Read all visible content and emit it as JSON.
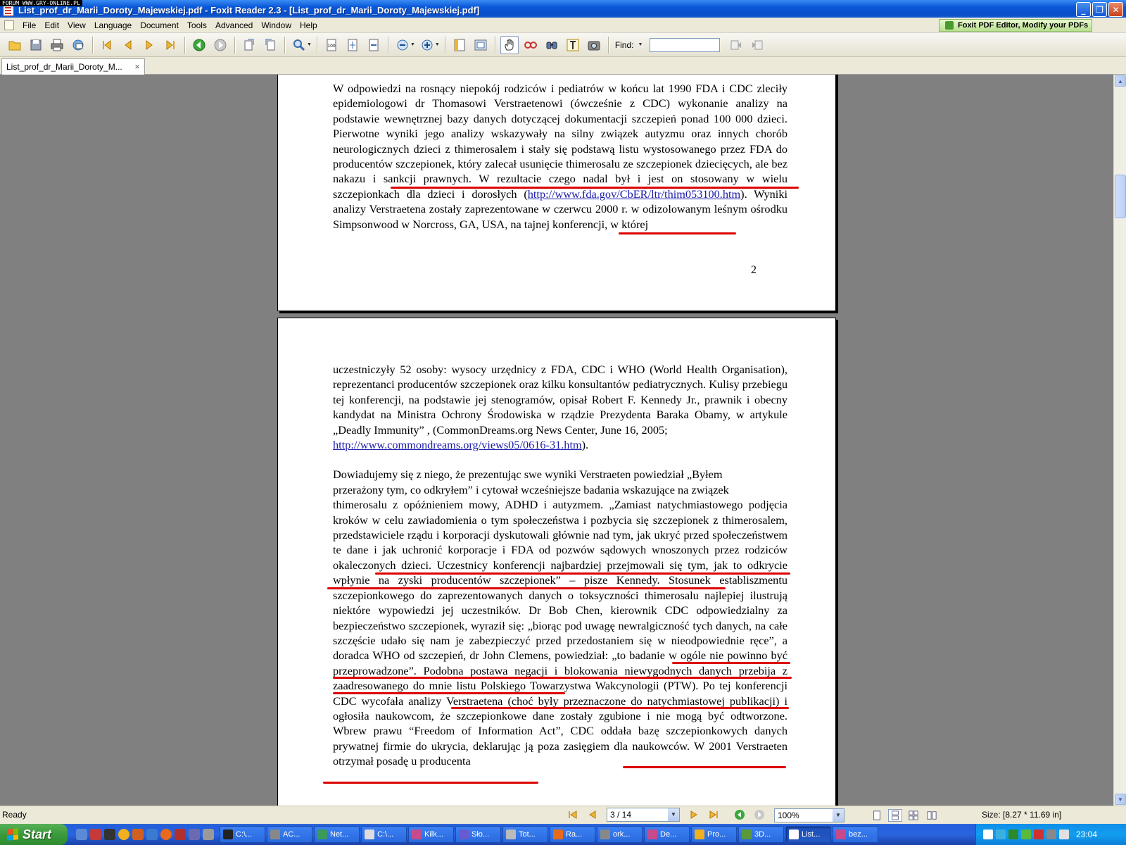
{
  "watermark": "FORUM WWW.GRY-ONLINE.PL",
  "window": {
    "title": "List_prof_dr_Marii_Doroty_Majewskiej.pdf - Foxit Reader 2.3 - [List_prof_dr_Marii_Doroty_Majewskiej.pdf]",
    "minimize": "_",
    "restore": "❐",
    "close": "✕"
  },
  "menu": {
    "items": [
      {
        "label": "File",
        "key": "F"
      },
      {
        "label": "Edit",
        "key": "E"
      },
      {
        "label": "View",
        "key": "V"
      },
      {
        "label": "Language",
        "key": "L"
      },
      {
        "label": "Document",
        "key": "D"
      },
      {
        "label": "Tools",
        "key": "T"
      },
      {
        "label": "Advanced",
        "key": "A"
      },
      {
        "label": "Window",
        "key": "W"
      },
      {
        "label": "Help",
        "key": "H"
      }
    ],
    "promo": "Foxit PDF Editor, Modify your PDFs"
  },
  "toolbar": {
    "find_label": "Find:",
    "find_value": ""
  },
  "tab": {
    "label": "List_prof_dr_Marii_Doroty_M...",
    "close": "×"
  },
  "page1": {
    "line1": "W odpowiedzi na rosnący niepokój rodziców i pediatrów w końcu lat 1990 FDA i CDC zleciły epidemiologowi dr Thomasowi Verstraetenowi (ówcześnie z CDC) wykonanie analizy na podstawie wewnętrznej bazy danych dotyczącej dokumentacji szczepień ponad 100 000 dzieci. Pierwotne wyniki jego analizy wskazywały na silny związek autyzmu oraz innych chorób neurologicznych dzieci z thimerosalem i stały się podstawą listu wystosowanego przez FDA do producentów szczepionek, który zalecał usunięcie thimerosalu ze szczepionek dziecięcych, ale bez nakazu i sankcji prawnych. W rezultacie czego nadal był i jest on stosowany w wielu szczepionkach dla dzieci i dorosłych (",
    "link": "http://www.fda.gov/CbER/ltr/thim053100.htm",
    "line2": "). Wyniki analizy Verstraetena zostały zaprezentowane w czerwcu 2000 r. w odizolowanym leśnym ośrodku Simpsonwood w Norcross, GA, USA, na tajnej konferencji, w której",
    "page_number": "2"
  },
  "page2": {
    "para1": "uczestniczyły 52 osoby: wysocy urzędnicy z FDA, CDC i WHO (World Health Organisation), reprezentanci producentów szczepionek oraz kilku konsultantów pediatrycznych. Kulisy przebiegu tej konferencji, na podstawie jej stenogramów, opisał Robert F. Kennedy Jr., prawnik i obecny kandydat na Ministra Ochrony Środowiska w rządzie Prezydenta Baraka Obamy, w artykule „Deadly Immunity” , (CommonDreams.org News Center, June 16, 2005;",
    "link": "http://www.commondreams.org/views05/0616-31.htm",
    "link_after": ").",
    "para2_first": "Dowiadujemy się z niego, że prezentując swe wyniki Verstraeten powiedział „Byłem",
    "para2_second": "przerażony tym, co odkryłem” i cytował wcześniejsze badania wskazujące na związek",
    "para2": "thimerosalu z opóźnieniem mowy, ADHD i autyzmem. „Zamiast natychmiastowego podjęcia kroków w celu zawiadomienia o tym społeczeństwa i pozbycia się szczepionek z thimerosalem, przedstawiciele rządu i korporacji dyskutowali głównie nad tym, jak ukryć przed społeczeństwem te dane i jak uchronić korporacje i FDA od pozwów sądowych wnoszonych przez rodziców okaleczonych dzieci. Uczestnicy konferencji najbardziej przejmowali się tym, jak to odkrycie wpłynie na zyski producentów szczepionek” – pisze Kennedy. Stosunek establiszmentu szczepionkowego do zaprezentowanych danych o toksyczności thimerosalu najlepiej ilustrują niektóre wypowiedzi jej uczestników. Dr Bob Chen, kierownik CDC odpowiedzialny za bezpieczeństwo szczepionek, wyraził się: „biorąc pod uwagę newralgiczność tych danych, na całe szczęście udało się nam je zabezpieczyć przed przedostaniem się w nieodpowiednie ręce”, a doradca WHO od szczepień, dr John Clemens, powiedział: „to badanie w ogóle nie powinno być przeprowadzone”. Podobna postawa negacji i blokowania niewygodnych danych przebija z zaadresowanego do mnie listu Polskiego Towarzystwa Wakcynologii (PTW). Po tej konferencji CDC wycofała analizy Verstraetena (choć były przeznaczone do natychmiastowej publikacji) i ogłosiła naukowcom, że szczepionkowe dane zostały zgubione i nie mogą być odtworzone. Wbrew prawu “Freedom of Information Act”, CDC oddała bazę szczepionkowych danych prywatnej firmie do ukrycia, deklarując ją poza zasięgiem dla naukowców. W 2001 Verstraeten otrzymał posadę u producenta"
  },
  "status": {
    "text": "Ready",
    "page_field": "3 / 14",
    "zoom": "100%",
    "size": "Size: [8.27 * 11.69 in]"
  },
  "taskbar": {
    "start": "Start",
    "tasks": [
      "C:\\...",
      "AC...",
      "Net...",
      "C:\\...",
      "Kilk...",
      "Sło...",
      "Tot...",
      "Ra...",
      "ork...",
      "De...",
      "Pro...",
      "3D...",
      "List...",
      "bez..."
    ],
    "clock": "23:04"
  },
  "colors": {
    "annotation": "#dd0000",
    "link": "#1a1aaa",
    "titlebar": "#0a58d8"
  }
}
